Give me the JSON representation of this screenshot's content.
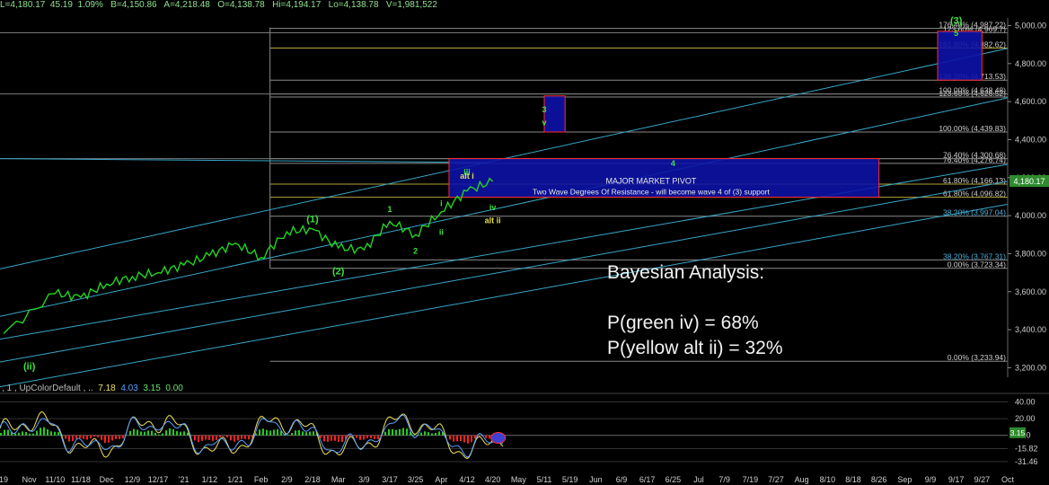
{
  "header": {
    "last": "L=4,180.17",
    "change": "45.19",
    "change_pct": "1.09%",
    "bid": "B=4,150.86",
    "ask": "A=4,218.48",
    "open": "O=4,138.78",
    "high": "Hi=4,194.17",
    "low": "Lo=4,138.78",
    "volume": "V=1,981,522"
  },
  "price_badge": "4,180.17",
  "indicator": {
    "label": ", 1 , UpColorDefault , ..",
    "v1": "7.18",
    "v2": "4.03",
    "v3": "3.15",
    "v4": "0.00",
    "badge": "3.15",
    "right_ticks": [
      {
        "value": 40,
        "label": "40.00"
      },
      {
        "value": 20,
        "label": "20.00"
      },
      {
        "value": 0,
        "label": "0.00"
      },
      {
        "value": -15.82,
        "label": "-15.82"
      },
      {
        "value": -31.46,
        "label": "-31.46"
      }
    ]
  },
  "bayesian": {
    "title": "Bayesian Analysis:",
    "line1": "P(green iv) = 68%",
    "line2": "P(yellow alt ii) = 32%"
  },
  "colors": {
    "price_line": "#22d422",
    "fib_line": "#8a8a8a",
    "channel": "#37a6c8",
    "box_fill": "#0d12a8",
    "box_border": "#ff2a2a",
    "wave_green": "#3ee03e",
    "wave_yellow": "#e6df4a",
    "histo_red": "#ff2020",
    "histo_green": "#22cc22"
  },
  "chart_data": {
    "type": "line",
    "x_labels": [
      "19",
      "Nov",
      "11/10",
      "11/18",
      "Dec",
      "12/9",
      "12/17",
      "'21",
      "1/12",
      "1/21",
      "Feb",
      "2/9",
      "2/18",
      "Mar",
      "3/9",
      "3/17",
      "3/25",
      "Apr",
      "4/12",
      "4/20",
      "May",
      "5/11",
      "5/19",
      "Jun",
      "6/9",
      "6/17",
      "6/25",
      "Jul",
      "7/9",
      "7/19",
      "7/27",
      "Aug",
      "8/10",
      "8/18",
      "8/26",
      "Sep",
      "9/9",
      "9/17",
      "9/27",
      "Oct"
    ],
    "y_ticks": [
      3200,
      3400,
      3600,
      3800,
      4000,
      4200,
      4400,
      4600,
      4800,
      5000
    ],
    "y_tick_labels": [
      "3,200.00",
      "3,400.00",
      "3,600.00",
      "3,800.00",
      "4,000.00",
      "4,200.00",
      "4,400.00",
      "4,600.00",
      "4,800.00",
      "5,000.00"
    ],
    "ylim": [
      3150,
      5040
    ],
    "series": [
      {
        "points": [
          [
            "19",
            3380
          ],
          [
            "11/10",
            3590
          ],
          [
            "11/18",
            3570
          ],
          [
            "Dec",
            3640
          ],
          [
            "12/9",
            3680
          ],
          [
            "12/17",
            3700
          ],
          [
            "'21",
            3740
          ],
          [
            "1/12",
            3790
          ],
          [
            "1/21",
            3855
          ],
          [
            "Feb",
            3780
          ],
          [
            "2/9",
            3915
          ],
          [
            "2/18",
            3930
          ],
          [
            "Mar",
            3830
          ],
          [
            "3/9",
            3820
          ],
          [
            "3/17",
            3970
          ],
          [
            "3/25",
            3900
          ],
          [
            "Apr",
            4020
          ],
          [
            "4/12",
            4130
          ],
          [
            "4/20",
            4180
          ]
        ]
      }
    ],
    "fib_levels": [
      {
        "label": "176.40% (4,987.22)",
        "price": 4985
      },
      {
        "label": "123.60% (4,969.7)",
        "price": 4962
      },
      {
        "label": "161.80% (4,882.62)",
        "price": 4882
      },
      {
        "label": "138.20% (4,713.53)",
        "price": 4713
      },
      {
        "label": "100.00% (4,638.48)",
        "price": 4640
      },
      {
        "label": "123.60% (4,626.52)",
        "price": 4624
      },
      {
        "label": "100.00% (4,439.83)",
        "price": 4440
      },
      {
        "label": "76.40% (4,300.68)",
        "price": 4300
      },
      {
        "label": "76.40% (4,276.74)",
        "price": 4275
      },
      {
        "label": "61.80% (4,166.13)",
        "price": 4166
      },
      {
        "label": "61.80% (4,096.82)",
        "price": 4097
      },
      {
        "label": "38.20% (3,997.04)",
        "price": 3997
      },
      {
        "label": "38.20% (3,767.31)",
        "price": 3767
      },
      {
        "label": "0.00% (3,723.34)",
        "price": 3723
      },
      {
        "label": "0.00% (3,233.94)",
        "price": 3234
      }
    ],
    "pivot_box": {
      "title": "MAJOR MARKET PIVOT",
      "subtitle": "Two Wave Degrees Of Resistance - will become wave 4 of (3) support",
      "from": "4/1",
      "to": "8/26",
      "top": 4300,
      "bottom": 4097
    },
    "target_boxes": [
      {
        "from": "5/11",
        "to": "5/25",
        "top": 4630,
        "bottom": 4440
      },
      {
        "from": "9/9",
        "to": "9/27",
        "top": 4970,
        "bottom": 4713
      }
    ],
    "wave_labels": [
      {
        "text": "(ii)",
        "x": "Nov",
        "price": 3190,
        "color": "green"
      },
      {
        "text": "(1)",
        "x": "2/18",
        "price": 3965,
        "color": "green"
      },
      {
        "text": "(2)",
        "x": "Mar",
        "price": 3690,
        "color": "green"
      },
      {
        "text": "1",
        "x": "3/17",
        "price": 4020,
        "color": "green"
      },
      {
        "text": "i",
        "x": "Apr",
        "price": 4050,
        "color": "green"
      },
      {
        "text": "ii",
        "x": "Apr",
        "price": 3900,
        "color": "green"
      },
      {
        "text": "2",
        "x": "3/25",
        "price": 3800,
        "color": "green"
      },
      {
        "text": "alt i",
        "x": "4/12",
        "price": 4195,
        "color": "yellow"
      },
      {
        "text": "iii",
        "x": "4/12",
        "price": 4215,
        "color": "green"
      },
      {
        "text": "iv",
        "x": "4/20",
        "price": 4030,
        "color": "green"
      },
      {
        "text": "alt ii",
        "x": "4/20",
        "price": 3960,
        "color": "yellow"
      },
      {
        "text": "3",
        "x": "5/11",
        "price": 4545,
        "color": "green"
      },
      {
        "text": "v",
        "x": "5/11",
        "price": 4475,
        "color": "green"
      },
      {
        "text": "4",
        "x": "6/25",
        "price": 4260,
        "color": "green"
      },
      {
        "text": "(3)",
        "x": "9/17",
        "price": 5010,
        "color": "green"
      },
      {
        "text": "5",
        "x": "9/17",
        "price": 4945,
        "color": "green"
      }
    ]
  }
}
